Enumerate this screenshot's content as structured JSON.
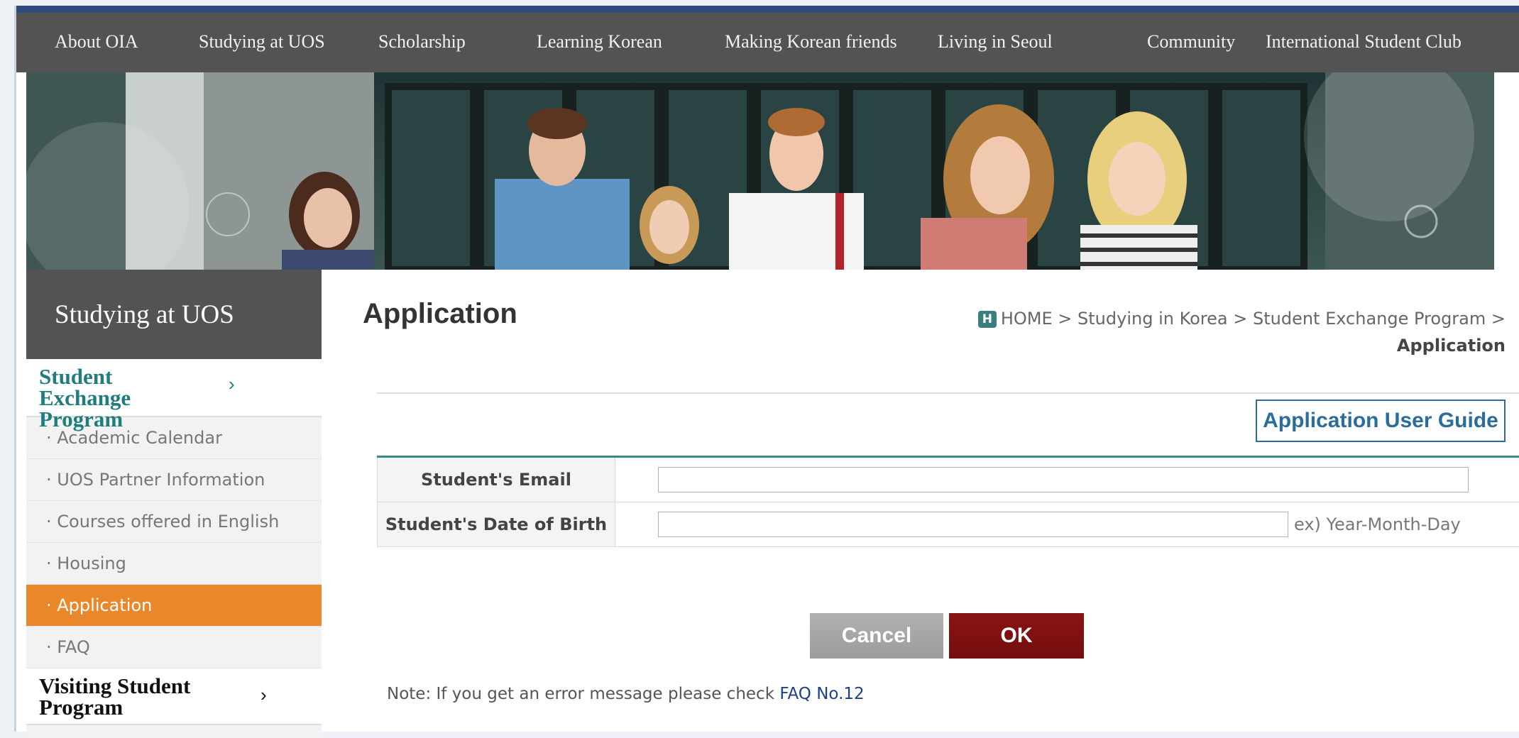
{
  "nav": {
    "items": [
      {
        "label": "About OIA"
      },
      {
        "label": "Studying at UOS"
      },
      {
        "label": "Scholarship"
      },
      {
        "label": "Learning Korean"
      },
      {
        "label": "Making Korean friends"
      },
      {
        "label": "Living in Seoul"
      },
      {
        "label": "Community"
      },
      {
        "label": "International Student Club"
      }
    ]
  },
  "sidebar": {
    "title": "Studying at UOS",
    "section1": {
      "label": "Student Exchange Program",
      "chevron": "›"
    },
    "items": [
      {
        "label": "· Academic Calendar"
      },
      {
        "label": "· UOS Partner Information"
      },
      {
        "label": "· Courses offered in English"
      },
      {
        "label": "· Housing"
      },
      {
        "label": "· Application"
      },
      {
        "label": "· FAQ"
      }
    ],
    "section2": {
      "label": "Visiting Student Program",
      "chevron": "›"
    }
  },
  "main": {
    "title": "Application",
    "breadcrumb": {
      "home_badge": "H",
      "path": "HOME > Studying in Korea > Student Exchange Program >",
      "current": "Application"
    },
    "guide_button": "Application User Guide",
    "form": {
      "email_label": "Student's Email",
      "email_value": "",
      "dob_label": "Student's Date of Birth",
      "dob_value": "",
      "dob_hint": "ex) Year-Month-Day"
    },
    "cancel_label": "Cancel",
    "ok_label": "OK",
    "note": {
      "text": "Note: If you get an error message please check ",
      "link": "FAQ No.12"
    }
  },
  "colors": {
    "nav_bg": "#535353",
    "accent_teal": "#3a8a8c",
    "active_orange": "#e9872a",
    "ok_red": "#8a1414",
    "link_blue": "#2b6d9a"
  }
}
